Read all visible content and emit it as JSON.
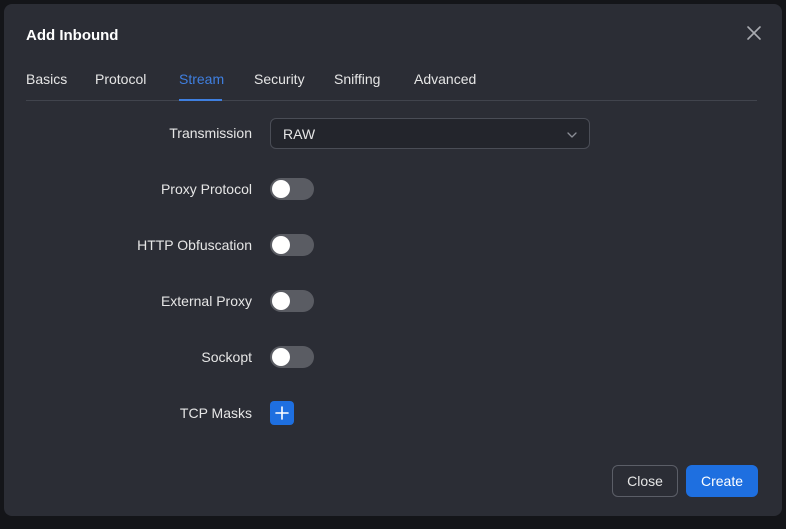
{
  "modal": {
    "title": "Add Inbound"
  },
  "tabs": [
    {
      "label": "Basics"
    },
    {
      "label": "Protocol"
    },
    {
      "label": "Stream"
    },
    {
      "label": "Security"
    },
    {
      "label": "Sniffing"
    },
    {
      "label": "Advanced"
    }
  ],
  "active_tab": "Stream",
  "form": {
    "transmission": {
      "label": "Transmission",
      "value": "RAW"
    },
    "proxy_protocol": {
      "label": "Proxy Protocol",
      "enabled": false
    },
    "http_obfuscation": {
      "label": "HTTP Obfuscation",
      "enabled": false
    },
    "external_proxy": {
      "label": "External Proxy",
      "enabled": false
    },
    "sockopt": {
      "label": "Sockopt",
      "enabled": false
    },
    "tcp_masks": {
      "label": "TCP Masks"
    }
  },
  "footer": {
    "close_label": "Close",
    "create_label": "Create"
  },
  "colors": {
    "accent": "#1e6fe0",
    "tab_active": "#3f7fe0",
    "modal_bg": "#2b2d35"
  },
  "icons": {
    "close": "close-icon",
    "dropdown": "chevron-down-icon",
    "add": "plus-icon"
  }
}
